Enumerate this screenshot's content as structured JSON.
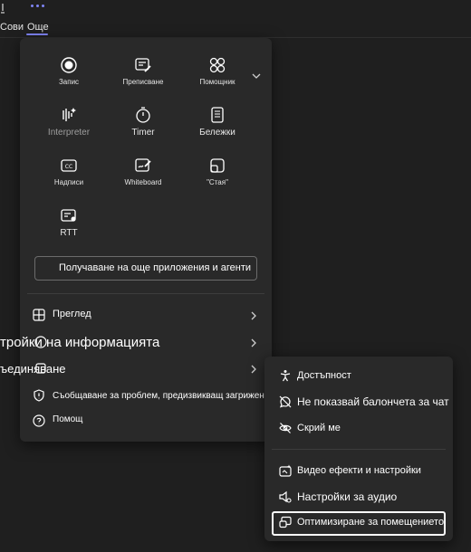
{
  "topbar": {
    "chat_label": "Сови",
    "more_label": "Още",
    "accent": "#7f85f5"
  },
  "apps": [
    {
      "label": "Запис",
      "icon": "record-icon"
    },
    {
      "label": "Преписване",
      "icon": "transcription-icon"
    },
    {
      "label": "Помощник",
      "icon": "copilot-icon"
    },
    {
      "label": "Interpreter",
      "icon": "interpreter-icon"
    },
    {
      "label": "Timer",
      "icon": "timer-icon"
    },
    {
      "label": "Бележки",
      "icon": "notes-icon"
    },
    {
      "label": "Надписи",
      "icon": "captions-icon"
    },
    {
      "label": "Whiteboard",
      "icon": "whiteboard-icon"
    },
    {
      "label": "\"Стая\"",
      "icon": "room-icon"
    },
    {
      "label": "RTT",
      "icon": "rtt-icon"
    }
  ],
  "get_apps_label": "Получаване на още приложения и агенти",
  "menu": {
    "view": "Преглед",
    "info_settings": "тройки на информацията",
    "connect": "ъединяване",
    "report_problem": "Съобщаване за проблем, предизвикващ загриженост",
    "help": "Помощ"
  },
  "submenu": {
    "accessibility": "Достъпност",
    "no_chat_bubbles": "Не показвай балончета за чат",
    "hide_me": "Скрий ме",
    "video_effects": "Видео ефекти и настройки",
    "audio_settings": "Настройки за аудио",
    "optimize_room": "Оптимизиране за помещението"
  }
}
